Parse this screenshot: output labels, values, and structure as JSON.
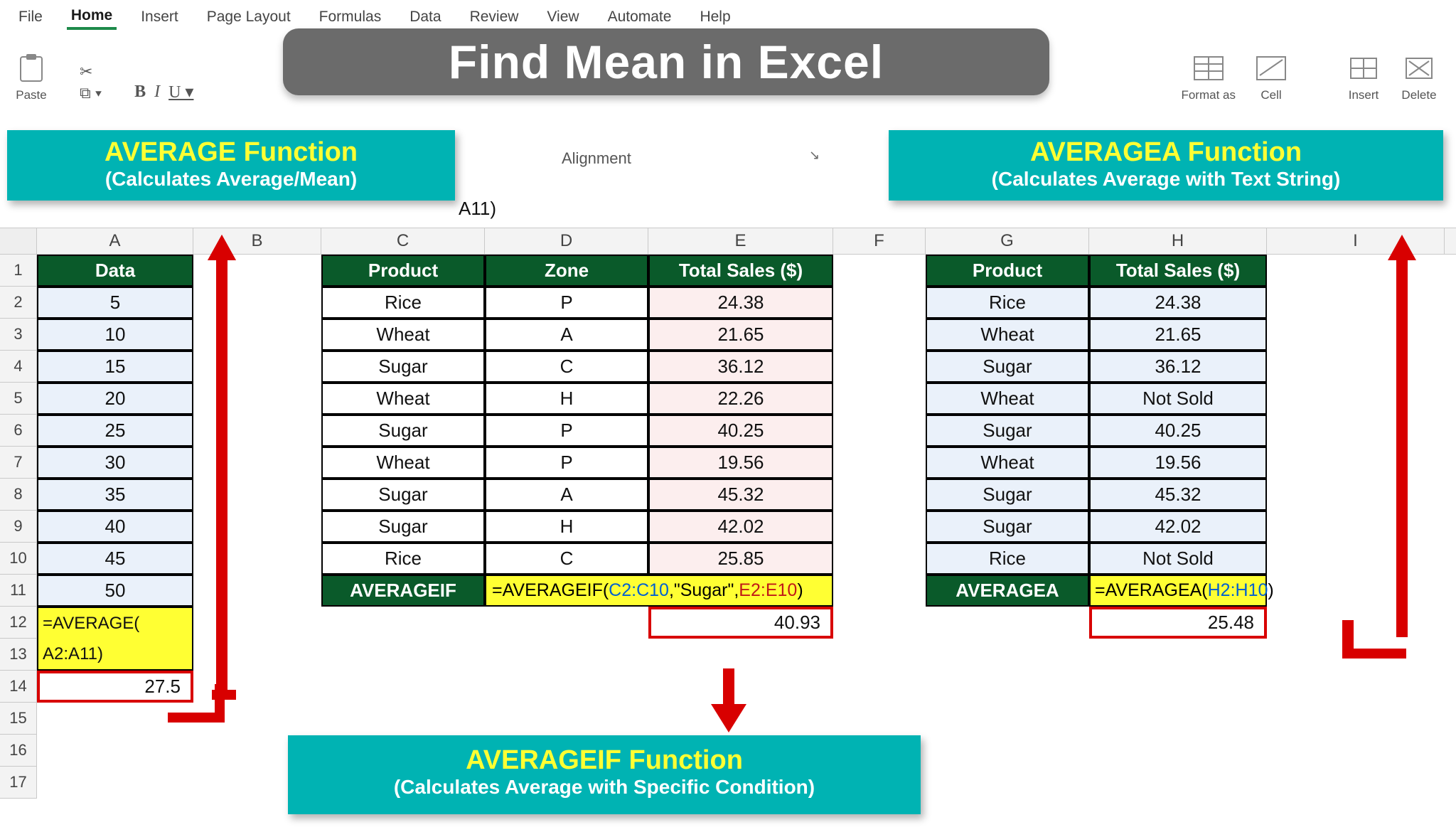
{
  "menu": {
    "file": "File",
    "home": "Home",
    "insert": "Insert",
    "page_layout": "Page Layout",
    "formulas": "Formulas",
    "data": "Data",
    "review": "Review",
    "view": "View",
    "automate": "Automate",
    "help": "Help"
  },
  "ribbon": {
    "paste": "Paste",
    "format_as": "Format as",
    "cell": "Cell",
    "insert_btn": "Insert",
    "delete_btn": "Delete"
  },
  "title_banner": "Find Mean in Excel",
  "callouts": {
    "left_title": "AVERAGE Function",
    "left_sub": "(Calculates Average/Mean)",
    "right_title": "AVERAGEA Function",
    "right_sub": "(Calculates Average with Text String)",
    "bottom_title": "AVERAGEIF Function",
    "bottom_sub": "(Calculates Average with Specific Condition)"
  },
  "groups": {
    "alignment": "Alignment"
  },
  "formula_bar_fragment": "A11)",
  "columns": {
    "A": "A",
    "B": "B",
    "C": "C",
    "D": "D",
    "E": "E",
    "F": "F",
    "G": "G",
    "H": "H",
    "I": "I"
  },
  "rows": [
    "1",
    "2",
    "3",
    "4",
    "5",
    "6",
    "7",
    "8",
    "9",
    "10",
    "11",
    "12",
    "13",
    "14",
    "15",
    "16",
    "17"
  ],
  "tableA": {
    "header": "Data",
    "values": [
      "5",
      "10",
      "15",
      "20",
      "25",
      "30",
      "35",
      "40",
      "45",
      "50"
    ],
    "formula_line1": "=AVERAGE(",
    "formula_line2": "A2:A11)",
    "result": "27.5"
  },
  "tableCDE": {
    "headers": {
      "c": "Product",
      "d": "Zone",
      "e": "Total Sales ($)"
    },
    "rows": [
      {
        "c": "Rice",
        "d": "P",
        "e": "24.38"
      },
      {
        "c": "Wheat",
        "d": "A",
        "e": "21.65"
      },
      {
        "c": "Sugar",
        "d": "C",
        "e": "36.12"
      },
      {
        "c": "Wheat",
        "d": "H",
        "e": "22.26"
      },
      {
        "c": "Sugar",
        "d": "P",
        "e": "40.25"
      },
      {
        "c": "Wheat",
        "d": "P",
        "e": "19.56"
      },
      {
        "c": "Sugar",
        "d": "A",
        "e": "45.32"
      },
      {
        "c": "Sugar",
        "d": "H",
        "e": "42.02"
      },
      {
        "c": "Rice",
        "d": "C",
        "e": "25.85"
      }
    ],
    "label": "AVERAGEIF",
    "formula_pre": "=AVERAGEIF(",
    "formula_arg1": "C2:C10",
    "formula_sep1": ",\"Sugar\",",
    "formula_arg2": "E2:E10",
    "formula_post": ")",
    "result": "40.93"
  },
  "tableGH": {
    "headers": {
      "g": "Product",
      "h": "Total Sales ($)"
    },
    "rows": [
      {
        "g": "Rice",
        "h": "24.38"
      },
      {
        "g": "Wheat",
        "h": "21.65"
      },
      {
        "g": "Sugar",
        "h": "36.12"
      },
      {
        "g": "Wheat",
        "h": "Not Sold"
      },
      {
        "g": "Sugar",
        "h": "40.25"
      },
      {
        "g": "Wheat",
        "h": "19.56"
      },
      {
        "g": "Sugar",
        "h": "45.32"
      },
      {
        "g": "Sugar",
        "h": "42.02"
      },
      {
        "g": "Rice",
        "h": "Not Sold"
      }
    ],
    "label": "AVERAGEA",
    "formula_pre": "=AVERAGEA(",
    "formula_arg": "H2:H10",
    "formula_post": ")",
    "result": "25.48"
  }
}
